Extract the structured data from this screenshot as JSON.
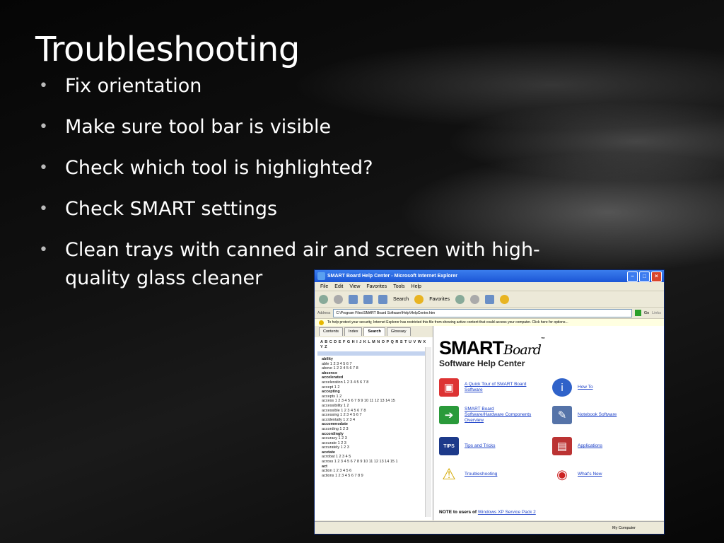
{
  "slide": {
    "title": "Troubleshooting",
    "bullets": [
      "Fix orientation",
      "Make sure tool bar is visible",
      "Check which tool is highlighted?",
      "Check SMART settings",
      "Clean trays with canned air and screen with high-quality glass cleaner"
    ]
  },
  "screenshot": {
    "window_title": "SMART Board Help Center - Microsoft Internet Explorer",
    "menu": [
      "File",
      "Edit",
      "View",
      "Favorites",
      "Tools",
      "Help"
    ],
    "toolbar": {
      "search": "Search",
      "favorites": "Favorites",
      "go": "Go",
      "links": "Links"
    },
    "address_label": "Address",
    "address": "C:\\Program Files\\SMART Board Software\\Help\\HelpCenter.htm",
    "infobar": "To help protect your security, Internet Explorer has restricted this file from showing active content that could access your computer. Click here for options...",
    "tabs": [
      "Contents",
      "Index",
      "Search",
      "Glossary"
    ],
    "alphabet": "A B C D E F G H I J K L M N O P Q R S T U V W X Y Z",
    "index_entries": [
      {
        "t": "ability",
        "b": true
      },
      {
        "t": "able 1 2 3 4 5 6 7",
        "b": false
      },
      {
        "t": "above 1 2 3 4 5 6 7 8",
        "b": false
      },
      {
        "t": "absence",
        "b": true
      },
      {
        "t": "accelerated",
        "b": true
      },
      {
        "t": "acceleration 1 2 3 4 5 6 7 8",
        "b": false
      },
      {
        "t": "accept 1 2",
        "b": false
      },
      {
        "t": "accepting",
        "b": true
      },
      {
        "t": "accepts 1 2",
        "b": false
      },
      {
        "t": "access 1 2 3 4 5 6 7 8 9 10 11 12 13 14 15",
        "b": false
      },
      {
        "t": "accessibility 1 2",
        "b": false
      },
      {
        "t": "accessible 1 2 3 4 5 6 7 8",
        "b": false
      },
      {
        "t": "accessing 1 2 3 4 5 6 7",
        "b": false
      },
      {
        "t": "accidentally 1 2 3 4",
        "b": false
      },
      {
        "t": "accommodate",
        "b": true
      },
      {
        "t": "according 1 2 3",
        "b": false
      },
      {
        "t": "accordingly",
        "b": true
      },
      {
        "t": "accuracy 1 2 3",
        "b": false
      },
      {
        "t": "accurate 1 2 3",
        "b": false
      },
      {
        "t": "accurately 1 2 3",
        "b": false
      },
      {
        "t": "acetate",
        "b": true
      },
      {
        "t": "acrobat 1 2 3 4 5",
        "b": false
      },
      {
        "t": "across 1 2 3 4 5 6 7 8 9 10 11 12 13 14 15 1",
        "b": false
      },
      {
        "t": "act",
        "b": true
      },
      {
        "t": "action 1 2 3 4 5 6",
        "b": false
      },
      {
        "t": "actions 1 2 3 4 5 6 7 8 9",
        "b": false
      }
    ],
    "logo_main": "SMART",
    "logo_script": "Board",
    "logo_tm": "™",
    "help_title": "Software Help Center",
    "links": [
      "A Quick Tour of SMART Board Software",
      "How To",
      "SMART Board Software/Hardware Components Overview",
      "Notebook Software",
      "Tips and Tricks",
      "Applications",
      "Troubleshooting",
      "What's New"
    ],
    "tips_label": "TIPS",
    "note_label": "NOTE to users of",
    "note_link": "Windows XP Service Pack 2",
    "status": "My Computer"
  },
  "colors": {
    "link": "#1a3fc8",
    "titlebar": "#1c56d6"
  }
}
